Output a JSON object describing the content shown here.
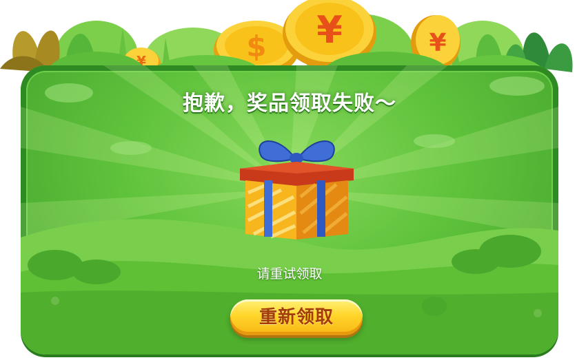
{
  "dialog": {
    "title": "抱歉，奖品领取失败～",
    "hint": "请重试领取",
    "retry_label": "重新领取"
  },
  "icons": {
    "coin_dollar": "dollar-coin-icon",
    "coin_yen": "yen-coin-icon",
    "gift": "gift-box-icon"
  },
  "coin_symbols": {
    "dollar": "$",
    "yen": "¥"
  },
  "colors": {
    "panel_green": "#5fc23b",
    "panel_border": "#2f8a24",
    "button_yellow": "#ffd52a",
    "button_text": "#a43b0a",
    "coin_gold": "#f9c21a"
  }
}
